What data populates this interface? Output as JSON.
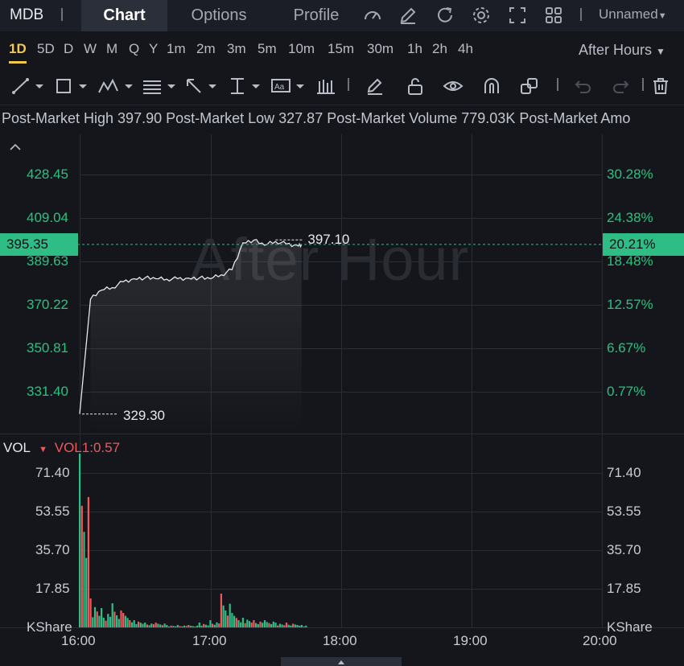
{
  "header": {
    "symbol": "MDB",
    "tabs": [
      "Chart",
      "Options",
      "Profile"
    ],
    "layout_name": "Unnamed",
    "icons": [
      "indicator-icon",
      "pencil-icon",
      "refresh-icon",
      "settings-icon",
      "fullscreen-icon",
      "layout-grid-icon"
    ]
  },
  "intervals": {
    "items": [
      "1D",
      "5D",
      "D",
      "W",
      "M",
      "Q",
      "Y",
      "1m",
      "2m",
      "3m",
      "5m",
      "10m",
      "15m",
      "30m",
      "1h",
      "2h",
      "4h"
    ],
    "active": "1D",
    "session": "After Hours"
  },
  "toolbar": {
    "tools": [
      "line-tool-icon",
      "rectangle-tool-icon",
      "pattern-tool-icon",
      "fib-tool-icon",
      "arrow-tool-icon",
      "measure-tool-icon",
      "text-tool-icon",
      "bars-tool-icon",
      "edit-icon",
      "lock-icon",
      "eye-icon",
      "magnet-icon",
      "clone-icon",
      "undo-icon",
      "redo-icon",
      "trash-icon"
    ]
  },
  "stats": {
    "text": "Post-Market High 397.90 Post-Market Low 327.87 Post-Market Volume 779.03K Post-Market Amo"
  },
  "chart": {
    "watermark": "After Hour",
    "current_price": "395.35",
    "current_pct": "20.21%",
    "high_label": "397.10",
    "low_label": "329.30",
    "price_axis_left": [
      "428.45",
      "409.04",
      "389.63",
      "370.22",
      "350.81",
      "331.40"
    ],
    "price_axis_right": [
      "30.28%",
      "24.38%",
      "18.48%",
      "12.57%",
      "6.67%",
      "0.77%"
    ],
    "time_axis": [
      "16:00",
      "17:00",
      "18:00",
      "19:00",
      "20:00"
    ],
    "colors": {
      "up": "#2ebd85",
      "down": "#f0585a",
      "accent": "#f2c94c"
    }
  },
  "volume": {
    "label": "VOL",
    "indicator": "VOL1:0.57",
    "axis": [
      "71.40",
      "53.55",
      "35.70",
      "17.85"
    ],
    "unit": "KShare"
  },
  "chart_data": {
    "type": "line",
    "title": "",
    "x": [
      "16:00",
      "16:05",
      "16:10",
      "16:15",
      "16:20",
      "16:25",
      "16:30",
      "16:35",
      "16:40",
      "16:45",
      "16:50",
      "16:55",
      "17:00",
      "17:05",
      "17:10",
      "17:15",
      "17:20",
      "17:25",
      "17:30",
      "17:35",
      "17:40",
      "17:42"
    ],
    "series": [
      {
        "values": [
          329.3,
          374.0,
          377.5,
          378.5,
          380.8,
          382.0,
          382.3,
          382.0,
          381.8,
          382.0,
          382.2,
          382.3,
          382.0,
          383.5,
          385.5,
          396.0,
          397.0,
          395.0,
          396.5,
          395.5,
          395.0,
          395.35
        ]
      }
    ],
    "ylim": [
      321.7,
      438.2
    ],
    "volume": [
      72,
      12,
      8,
      10,
      6,
      3,
      2,
      2,
      1,
      1,
      1,
      2,
      3,
      14,
      6,
      4,
      3,
      3,
      2,
      2,
      1,
      1
    ]
  }
}
